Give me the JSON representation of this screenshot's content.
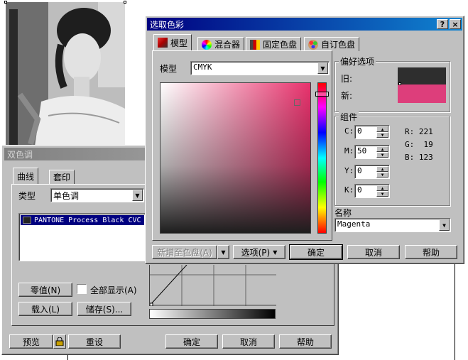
{
  "duotone": {
    "title": "双色调",
    "tabs": [
      {
        "label": "曲线"
      },
      {
        "label": "套印"
      }
    ],
    "type_label": "类型",
    "type_value": "单色调",
    "ink_list": [
      "PANTONE Process Black CVC"
    ],
    "buttons": {
      "null": "零值(N)",
      "show_all": "全部显示(A)",
      "load": "载入(L)",
      "save": "储存(S)...",
      "preview": "预览",
      "reset": "重设",
      "ok": "确定",
      "cancel": "取消",
      "help": "帮助"
    }
  },
  "color_dialog": {
    "title": "选取色彩",
    "titlebar_help": "?",
    "titlebar_close": "×",
    "tabs": [
      {
        "label": "模型"
      },
      {
        "label": "混合器"
      },
      {
        "label": "固定色盘"
      },
      {
        "label": "自订色盘"
      }
    ],
    "model_label": "模型",
    "model_value": "CMYK",
    "preferences": {
      "title": "偏好选项",
      "old_label": "旧:",
      "new_label": "新:",
      "old_color": "#2e2e2e",
      "new_color": "#dd3e7b"
    },
    "components": {
      "title": "组件",
      "c": {
        "label": "C:",
        "value": "0"
      },
      "m": {
        "label": "M:",
        "value": "50"
      },
      "y": {
        "label": "Y:",
        "value": "0"
      },
      "k": {
        "label": "K:",
        "value": "0"
      },
      "r": {
        "label": "R:",
        "value": "221"
      },
      "g": {
        "label": "G:",
        "value": "19"
      },
      "b": {
        "label": "B:",
        "value": "123"
      }
    },
    "name_label": "名称",
    "name_value": "Magenta",
    "buttons": {
      "add_palette": "新增至色盘(A)",
      "options": "选项(P)",
      "ok": "确定",
      "cancel": "取消",
      "help": "帮助"
    }
  }
}
